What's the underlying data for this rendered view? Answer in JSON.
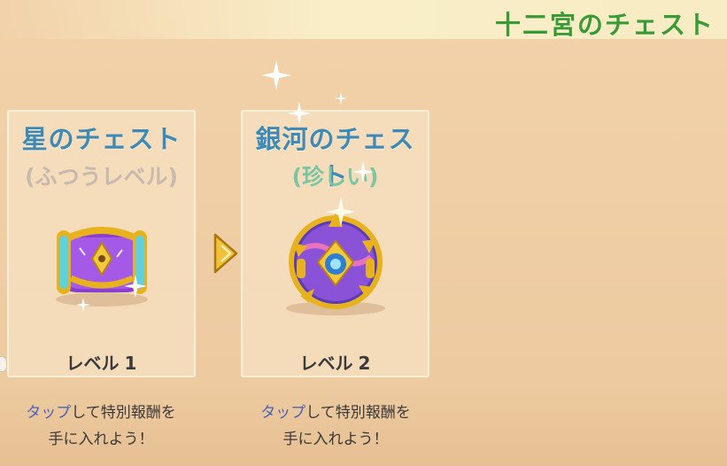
{
  "header": {
    "title": "十二宮のチェスト"
  },
  "chests": [
    {
      "name": "星のチェスト",
      "rarity": "(ふつうレベル)",
      "level_label": "レベル",
      "level_value": "1",
      "caption_tap": "タップ",
      "caption_rest": "して特別報酬を",
      "caption_line2": "手に入れよう！"
    },
    {
      "name": "銀河のチェスト",
      "rarity": "(珍しい)",
      "level_label": "レベル",
      "level_value": "2",
      "caption_tap": "タップ",
      "caption_rest": "して特別報酬を",
      "caption_line2": "手に入れよう！"
    }
  ],
  "colors": {
    "title": "#3b9a36",
    "chest_name": "#3f89b5",
    "rarity_common": "#c8b9ad",
    "rarity_rare": "#7bc6a2",
    "tap_highlight": "#4a63b8",
    "gold": "#e8b21e"
  },
  "icons": {
    "upgrade_arrow": "gold-triangle-arrow-icon",
    "sparkle": "sparkle-icon"
  }
}
